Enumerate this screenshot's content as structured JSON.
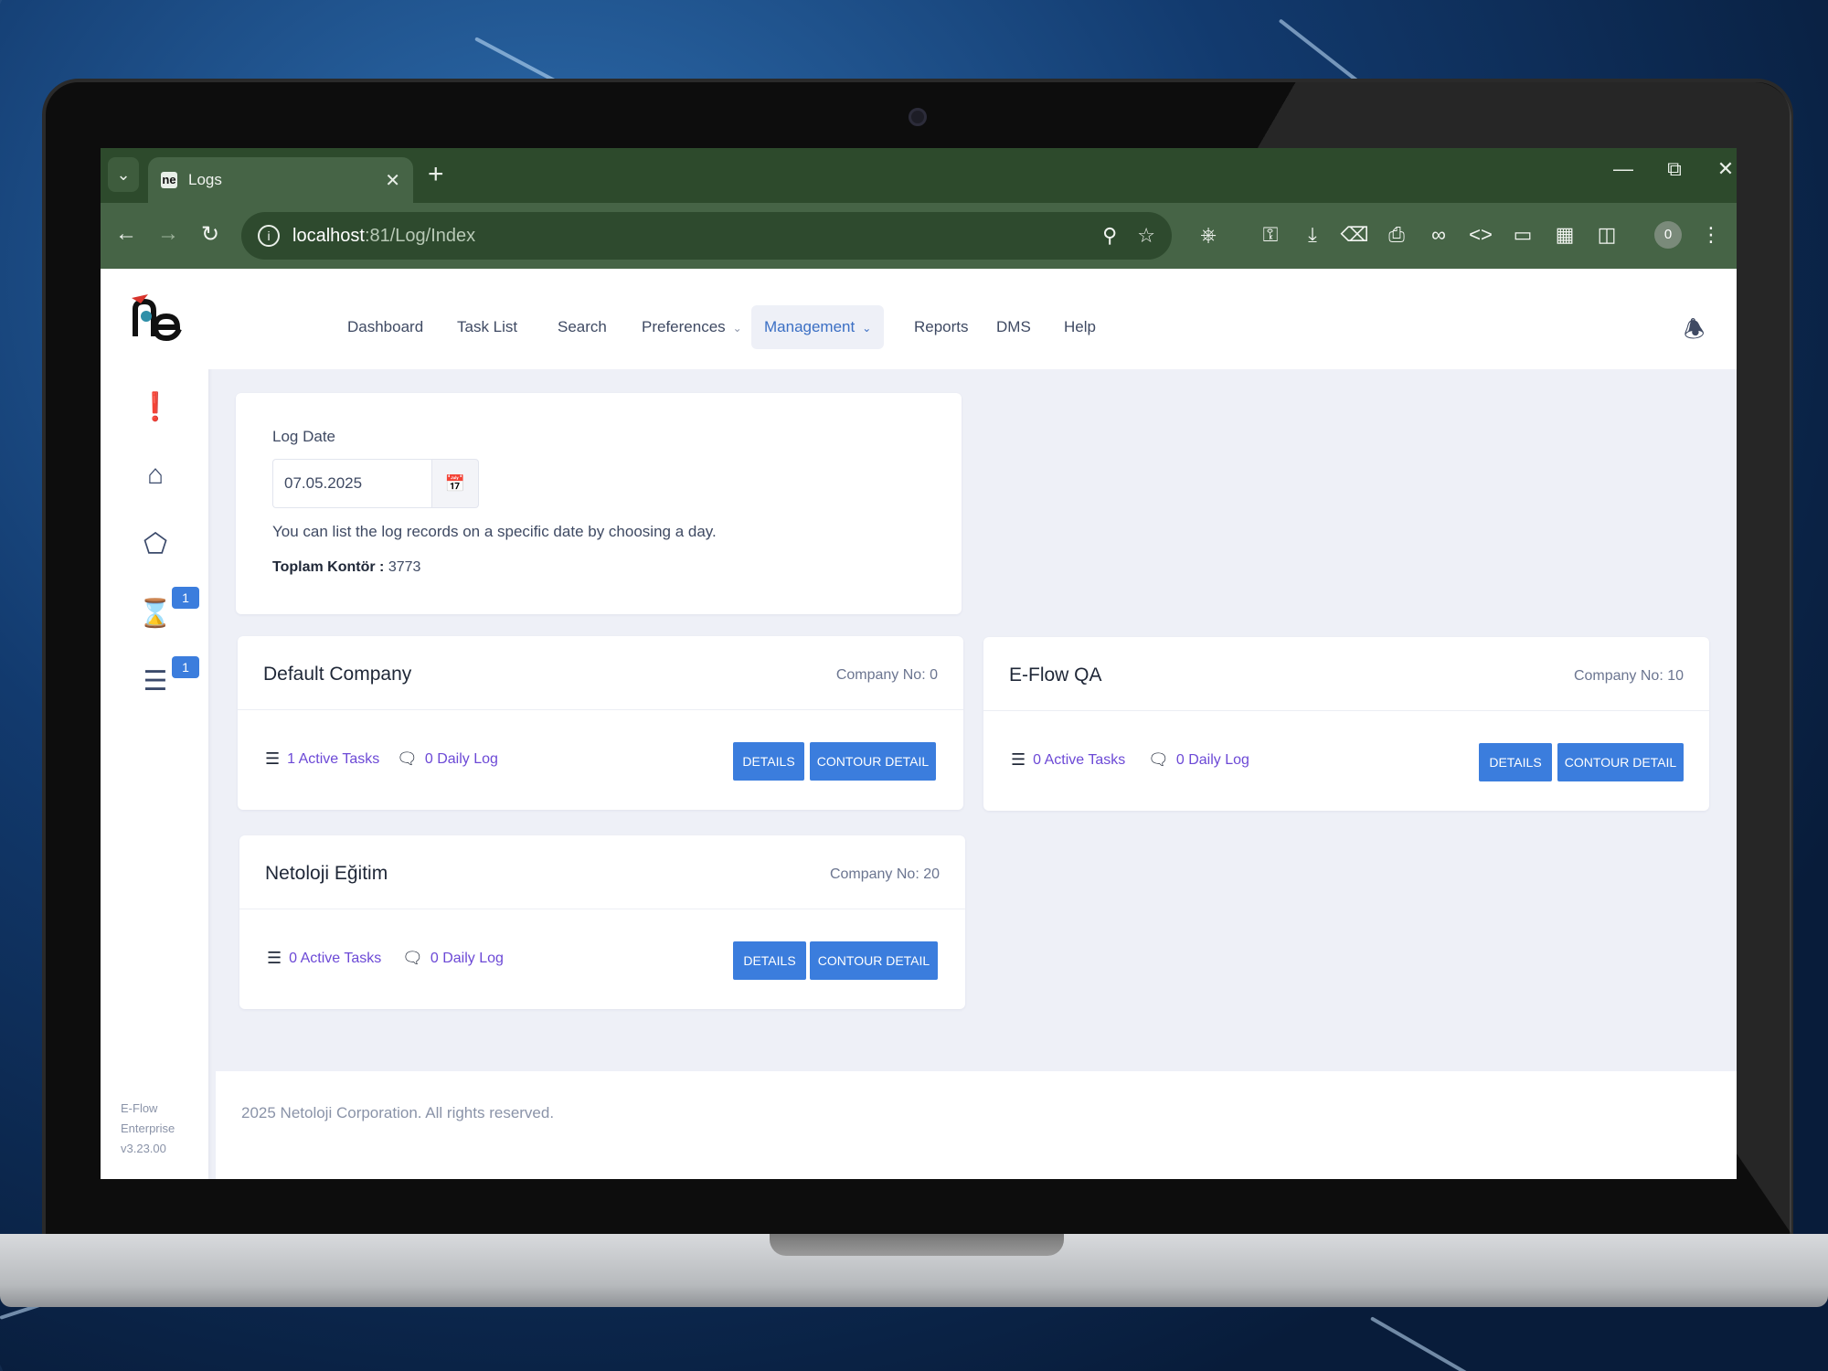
{
  "browser": {
    "tab_title": "Logs",
    "url_host": "localhost",
    "url_rest": ":81/Log/Index",
    "profile_count": "0"
  },
  "nav": {
    "items": [
      {
        "label": "Dashboard"
      },
      {
        "label": "Task List"
      },
      {
        "label": "Search"
      },
      {
        "label": "Preferences"
      },
      {
        "label": "Management"
      },
      {
        "label": "Reports"
      },
      {
        "label": "DMS"
      },
      {
        "label": "Help"
      }
    ]
  },
  "sidebar": {
    "badges": [
      "1",
      "1"
    ],
    "version_line1": "E-Flow",
    "version_line2": "Enterprise",
    "version_line3": "v3.23.00"
  },
  "log_date": {
    "label": "Log Date",
    "value": "07.05.2025",
    "hint": "You can list the log records on a specific date by choosing a day.",
    "total_label": "Toplam Kontör :",
    "total_value": "3773"
  },
  "companies": [
    {
      "name": "Default Company",
      "company_no": "Company No: 0",
      "active_tasks": "1 Active Tasks",
      "daily_log": "0 Daily Log",
      "details": "Details",
      "contour": "Contour Detail"
    },
    {
      "name": "E-Flow QA",
      "company_no": "Company No: 10",
      "active_tasks": "0 Active Tasks",
      "daily_log": "0 Daily Log",
      "details": "Details",
      "contour": "Contour Detail"
    },
    {
      "name": "Netoloji Eğitim",
      "company_no": "Company No: 20",
      "active_tasks": "0 Active Tasks",
      "daily_log": "0 Daily Log",
      "details": "Details",
      "contour": "Contour Detail"
    }
  ],
  "footer": {
    "text": "2025 Netoloji Corporation. All rights reserved."
  },
  "colors": {
    "accent": "#3b7ddd",
    "link": "#6c49d6",
    "browser_frame": "#466446"
  }
}
